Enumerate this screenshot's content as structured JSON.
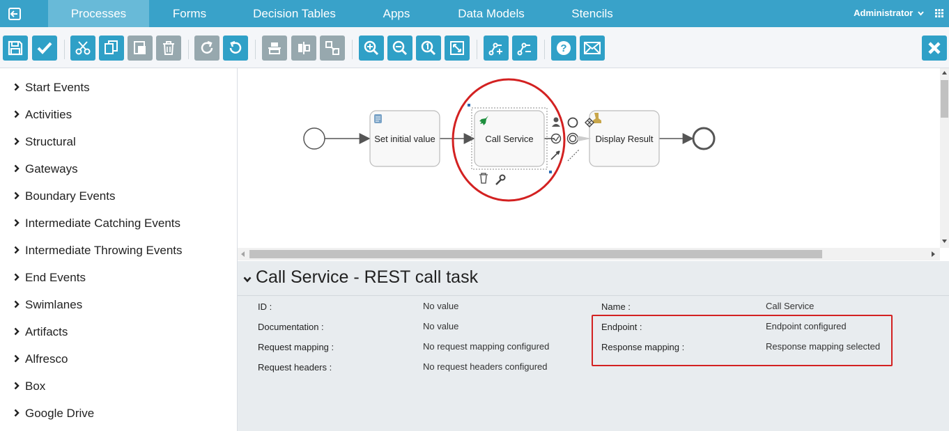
{
  "nav": {
    "tabs": [
      {
        "label": "Processes",
        "active": true
      },
      {
        "label": "Forms"
      },
      {
        "label": "Decision Tables"
      },
      {
        "label": "Apps"
      },
      {
        "label": "Data Models"
      },
      {
        "label": "Stencils"
      }
    ],
    "user": "Administrator"
  },
  "toolbar": {
    "buttons": [
      "save-icon",
      "validate-icon",
      "cut-icon",
      "copy-icon",
      "paste-icon",
      "delete-icon",
      "redo-icon",
      "undo-icon",
      "align-horizontal-icon",
      "align-vertical-icon",
      "same-size-icon",
      "zoom-in-icon",
      "zoom-out-icon",
      "zoom-actual-icon",
      "zoom-fit-icon",
      "add-bendpoint-icon",
      "remove-bendpoint-icon",
      "help-icon",
      "feedback-icon",
      "close-icon"
    ]
  },
  "palette": {
    "groups": [
      "Start Events",
      "Activities",
      "Structural",
      "Gateways",
      "Boundary Events",
      "Intermediate Catching Events",
      "Intermediate Throwing Events",
      "End Events",
      "Swimlanes",
      "Artifacts",
      "Alfresco",
      "Box",
      "Google Drive"
    ]
  },
  "diagram": {
    "tasks": [
      {
        "label": "Set initial value",
        "icon": "script-icon"
      },
      {
        "label": "Call Service",
        "icon": "rocket-icon"
      },
      {
        "label": "Display Result",
        "icon": "user-task-icon"
      }
    ]
  },
  "properties": {
    "title": "Call Service - REST call task",
    "left": [
      {
        "label": "ID :",
        "value": "No value"
      },
      {
        "label": "Documentation :",
        "value": "No value"
      },
      {
        "label": "Request mapping :",
        "value": "No request mapping configured"
      },
      {
        "label": "Request headers :",
        "value": "No request headers configured"
      }
    ],
    "right": [
      {
        "label": "Name :",
        "value": "Call Service"
      },
      {
        "label": "Endpoint :",
        "value": "Endpoint configured"
      },
      {
        "label": "Response mapping :",
        "value": "Response mapping selected"
      }
    ]
  },
  "colors": {
    "nav": "#39a2c9",
    "button": "#2fa0c7",
    "highlight": "#d32121"
  }
}
